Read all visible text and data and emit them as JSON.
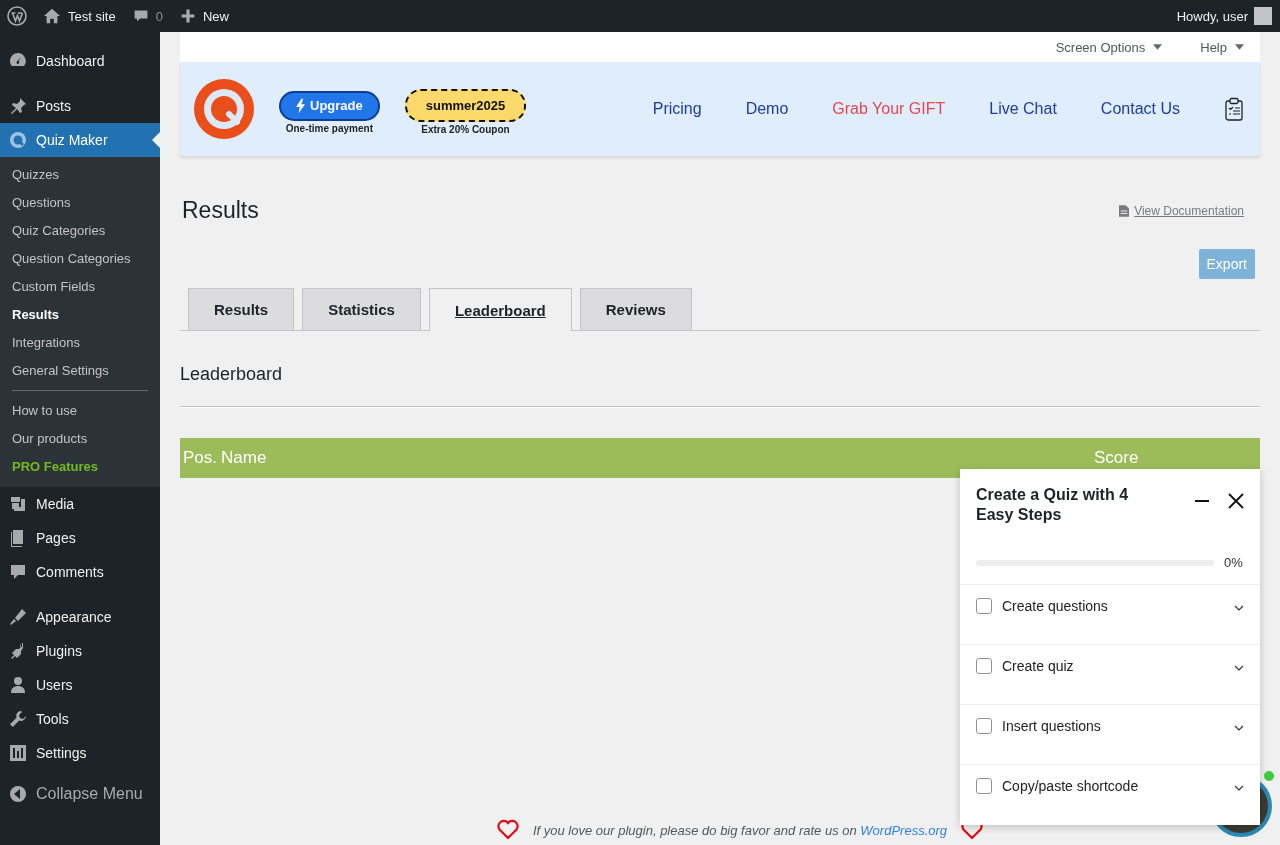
{
  "admin_bar": {
    "site": "Test site",
    "comments": "0",
    "new": "New",
    "greeting": "Howdy, user"
  },
  "sidebar": {
    "menu_groups": [
      [
        {
          "label": "Dashboard",
          "selected": false
        }
      ],
      [
        {
          "label": "Posts",
          "selected": false
        },
        {
          "label": "Quiz Maker",
          "selected": true,
          "submenu": [
            [
              {
                "label": "Quizzes",
                "selected": false,
                "kind": "item"
              },
              {
                "label": "Questions",
                "selected": false,
                "kind": "item"
              },
              {
                "label": "Quiz Categories",
                "selected": false,
                "kind": "item"
              },
              {
                "label": "Question Categories",
                "selected": false,
                "kind": "item"
              },
              {
                "label": "Custom Fields",
                "selected": false,
                "kind": "item"
              },
              {
                "label": "Results",
                "selected": true,
                "kind": "item"
              },
              {
                "label": "Integrations",
                "selected": false,
                "kind": "item"
              },
              {
                "label": "General Settings",
                "selected": false,
                "kind": "item"
              }
            ],
            [
              {
                "label": "How to use",
                "selected": false,
                "kind": "item"
              },
              {
                "label": "Our products",
                "selected": false,
                "kind": "item"
              },
              {
                "label": "PRO Features",
                "selected": false,
                "kind": "pro"
              }
            ]
          ]
        },
        {
          "label": "Media",
          "selected": false
        },
        {
          "label": "Pages",
          "selected": false
        },
        {
          "label": "Comments",
          "selected": false
        }
      ],
      [
        {
          "label": "Appearance",
          "selected": false
        },
        {
          "label": "Plugins",
          "selected": false
        },
        {
          "label": "Users",
          "selected": false
        },
        {
          "label": "Tools",
          "selected": false
        },
        {
          "label": "Settings",
          "selected": false
        }
      ]
    ],
    "collapse": "Collapse Menu"
  },
  "screen_meta": {
    "screen_options": "Screen Options",
    "help": "Help"
  },
  "banner": {
    "upgrade": {
      "label": "Upgrade",
      "note": "One-time payment"
    },
    "coupon": {
      "code": "summer2025",
      "note": "Extra 20% Coupon"
    },
    "nav": [
      {
        "label": "Pricing",
        "kind": "link"
      },
      {
        "label": "Demo",
        "kind": "link"
      },
      {
        "label": "Grab Your GIFT",
        "kind": "highlight"
      },
      {
        "label": "Live Chat",
        "kind": "link"
      },
      {
        "label": "Contact Us",
        "kind": "link"
      }
    ]
  },
  "page": {
    "title": "Results",
    "doc_link": "View Documentation",
    "export": "Export"
  },
  "tabs": [
    {
      "label": "Results",
      "selected": false
    },
    {
      "label": "Statistics",
      "selected": false
    },
    {
      "label": "Leaderboard",
      "selected": true
    },
    {
      "label": "Reviews",
      "selected": false
    }
  ],
  "section_title": "Leaderboard",
  "table": {
    "columns": [
      "Pos.",
      "Name",
      "Score"
    ]
  },
  "popup": {
    "title": "Create a Quiz with 4 Easy Steps",
    "progress": {
      "level": 0,
      "reading": "0%"
    },
    "steps": [
      {
        "label": "Create questions",
        "checked": false,
        "expanded": false
      },
      {
        "label": "Create quiz",
        "checked": false,
        "expanded": false
      },
      {
        "label": "Insert questions",
        "checked": false,
        "expanded": false
      },
      {
        "label": "Copy/paste shortcode",
        "checked": false,
        "expanded": false
      }
    ]
  },
  "footer": {
    "text": "If you love our plugin, please do big favor and rate us on ",
    "link": "WordPress.org"
  }
}
